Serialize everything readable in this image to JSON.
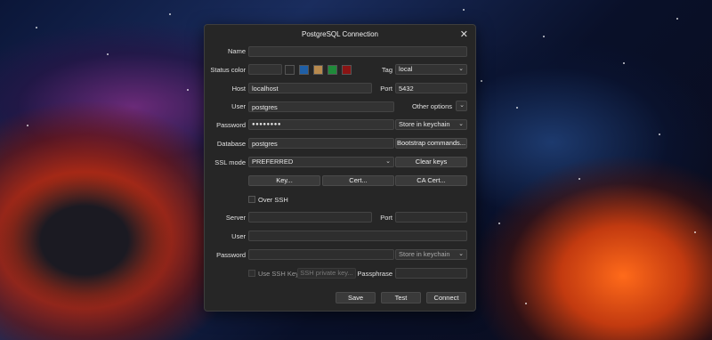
{
  "dialog": {
    "title": "PostgreSQL Connection",
    "close_glyph": "✕"
  },
  "labels": {
    "name": "Name",
    "status_color": "Status color",
    "tag": "Tag",
    "host": "Host",
    "port": "Port",
    "user": "User",
    "other_options": "Other options",
    "password": "Password",
    "database": "Database",
    "ssl_mode": "SSL mode",
    "over_ssh": "Over SSH",
    "server": "Server",
    "ssh_port": "Port",
    "ssh_user": "User",
    "ssh_password": "Password",
    "use_ssh_key": "Use SSH Key",
    "passphrase": "Passphrase"
  },
  "values": {
    "name": "",
    "tag": "local",
    "host": "localhost",
    "port": "5432",
    "user": "postgres",
    "password_mask": "●●●●●●●●",
    "password_storage": "Store in keychain",
    "database": "postgres",
    "ssl_mode": "PREFERRED",
    "server": "",
    "ssh_port": "",
    "ssh_user": "",
    "ssh_password": "",
    "ssh_password_storage": "Store in keychain",
    "passphrase": ""
  },
  "status_colors": [
    "#2a2a2a",
    "#1f5fa6",
    "#b88a4e",
    "#1f8a3a",
    "#8a1414"
  ],
  "buttons": {
    "bootstrap": "Bootstrap commands...",
    "clear_keys": "Clear keys",
    "key": "Key...",
    "cert": "Cert...",
    "ca_cert": "CA Cert...",
    "ssh_private_key": "SSH private key...",
    "save": "Save",
    "test": "Test",
    "connect": "Connect"
  }
}
